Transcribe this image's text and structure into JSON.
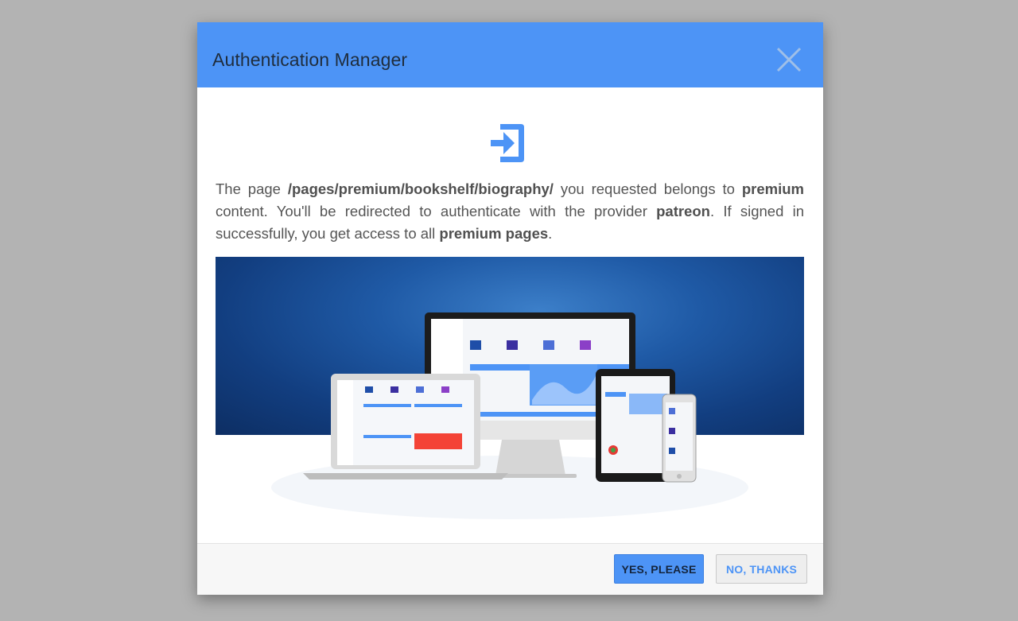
{
  "dialog": {
    "title": "Authentication Manager",
    "close_icon": "close-icon",
    "signin_icon": "sign-in-icon",
    "accent_color": "#4d94f6",
    "message": {
      "part1": "The page ",
      "path": "/pages/premium/bookshelf/biography/",
      "part2": " you requested belongs to ",
      "premium": "premium",
      "part3": " content. You'll be redirected to authenticate with the provider ",
      "provider": "patreon",
      "part4": ". If signed in successfully, you get access to all ",
      "premium_pages": "premium pages",
      "part5": "."
    },
    "banner_image": "responsive-dashboard-devices-illustration",
    "buttons": {
      "yes_label": "YES, PLEASE",
      "no_label": "NO, THANKS"
    }
  }
}
